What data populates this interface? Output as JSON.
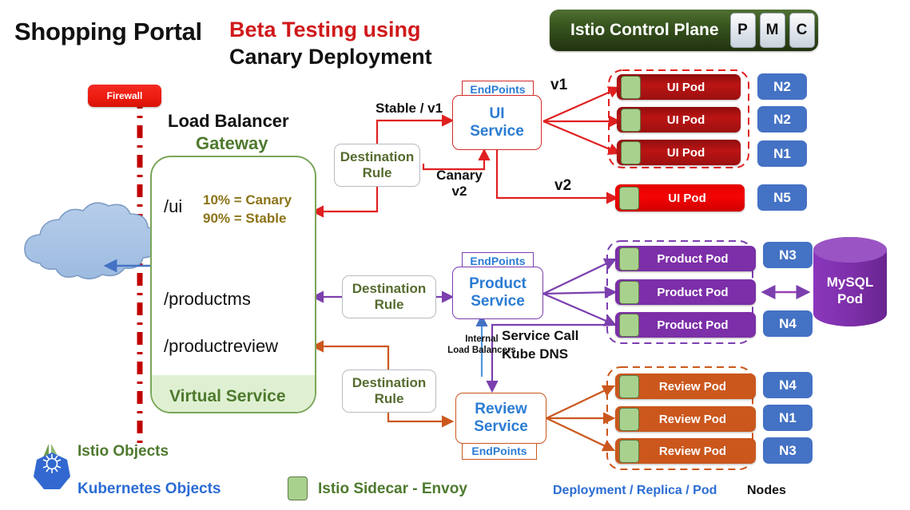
{
  "title": {
    "main": "Shopping Portal",
    "sub_red": "Beta Testing using",
    "sub_black": "Canary Deployment"
  },
  "control_plane": {
    "label": "Istio Control Plane",
    "buttons": [
      "P",
      "M",
      "C"
    ],
    "color": "#38551f"
  },
  "firewall": {
    "label": "Firewall",
    "color": "#ee1c10"
  },
  "gateway": {
    "title_top": "Load Balancer",
    "title_sub": "Gateway",
    "footer": "Virtual Service",
    "border_color": "#7aa559",
    "routes": [
      {
        "path": "/ui",
        "note_line1": "10% = Canary",
        "note_line2": "90% = Stable"
      },
      {
        "path": "/productms"
      },
      {
        "path": "/productreview"
      }
    ]
  },
  "destination_rules": [
    {
      "line1": "Destination",
      "line2": "Rule"
    },
    {
      "line1": "Destination",
      "line2": "Rule"
    },
    {
      "line1": "Destination",
      "line2": "Rule"
    }
  ],
  "services": [
    {
      "name_line1": "UI",
      "name_line2": "Service",
      "endpoints": "EndPoints",
      "endpoints_position": "top",
      "color": "#d32b2b"
    },
    {
      "name_line1": "Product",
      "name_line2": "Service",
      "endpoints": "EndPoints",
      "endpoints_position": "top",
      "color": "#7c3fae"
    },
    {
      "name_line1": "Review",
      "name_line2": "Service",
      "endpoints": "EndPoints",
      "endpoints_position": "bottom",
      "color": "#cb571d"
    }
  ],
  "flow_labels": {
    "stable": "Stable / v1",
    "canary_line1": "Canary",
    "canary_line2": "v2",
    "v1": "v1",
    "v2": "v2",
    "internal_lb_line1": "Internal",
    "internal_lb_line2": "Load Balancers",
    "service_call_line1": "Service Call",
    "service_call_line2": "Kube DNS"
  },
  "pods": {
    "ui_v1": [
      {
        "label": "UI Pod",
        "node": "N2"
      },
      {
        "label": "UI Pod",
        "node": "N2"
      },
      {
        "label": "UI Pod",
        "node": "N1"
      }
    ],
    "ui_v2": [
      {
        "label": "UI Pod",
        "node": "N5"
      }
    ],
    "product": [
      {
        "label": "Product Pod",
        "node": "N3"
      },
      {
        "label": "Product Pod",
        "node": ""
      },
      {
        "label": "Product Pod",
        "node": "N4"
      }
    ],
    "review": [
      {
        "label": "Review Pod",
        "node": "N4"
      },
      {
        "label": "Review Pod",
        "node": "N1"
      },
      {
        "label": "Review Pod",
        "node": "N3"
      }
    ]
  },
  "database": {
    "line1": "MySQL",
    "line2": "Pod",
    "color": "#7c2fa8"
  },
  "legend": {
    "istio": "Istio Objects",
    "kubernetes": "Kubernetes Objects",
    "sidecar": "Istio Sidecar - Envoy",
    "deployment": "Deployment / Replica / Pod",
    "nodes": "Nodes"
  }
}
